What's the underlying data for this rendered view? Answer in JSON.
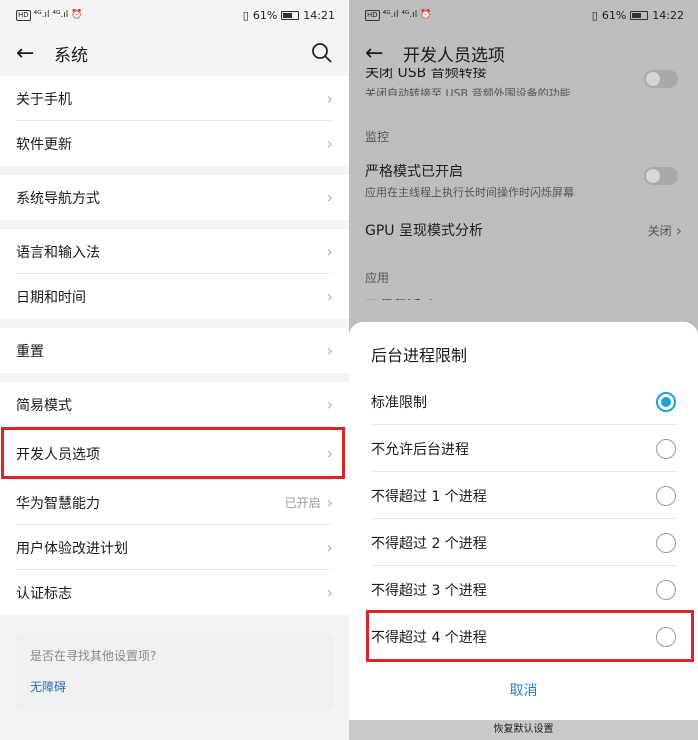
{
  "left": {
    "status": {
      "network": "⁴ᴳ.ıl ⁴ᴳ.ıl ⏰",
      "hd": "HD",
      "battery_pct": "61%",
      "time": "14:21"
    },
    "title": "系统",
    "groups": [
      [
        "关于手机",
        "软件更新"
      ],
      [
        "系统导航方式"
      ],
      [
        "语言和输入法",
        "日期和时间"
      ],
      [
        "重置"
      ],
      [
        "简易模式",
        "开发人员选项",
        "华为智慧能力",
        "用户体验改进计划",
        "认证标志"
      ]
    ],
    "smart_value": "已开启",
    "suggest_question": "是否在寻找其他设置项?",
    "suggest_link": "无障碍"
  },
  "right": {
    "status": {
      "network": "⁴ᴳ.ıl ⁴ᴳ.ıl ⏰",
      "hd": "HD",
      "battery_pct": "61%",
      "time": "14:22"
    },
    "title": "开发人员选项",
    "partial_title": "关闭 USB 音频转接",
    "partial_sub": "关闭自动转接至 USB 音频外围设备的功能",
    "section_monitor": "监控",
    "strict_title": "严格模式已开启",
    "strict_sub": "应用在主线程上执行长时间操作时闪烁屏幕",
    "gpu_title": "GPU 呈现模式分析",
    "gpu_value": "关闭",
    "section_apps": "应用",
    "partial_hidden": "不保留活动",
    "dialog": {
      "title": "后台进程限制",
      "options": [
        "标准限制",
        "不允许后台进程",
        "不得超过 1 个进程",
        "不得超过 2 个进程",
        "不得超过 3 个进程",
        "不得超过 4 个进程"
      ],
      "selected_index": 0,
      "cancel": "取消"
    },
    "restore_default": "恢复默认设置"
  },
  "colors": {
    "highlight": "#d9242c",
    "accent": "#1aa3d6",
    "link": "#2b7cc8"
  }
}
